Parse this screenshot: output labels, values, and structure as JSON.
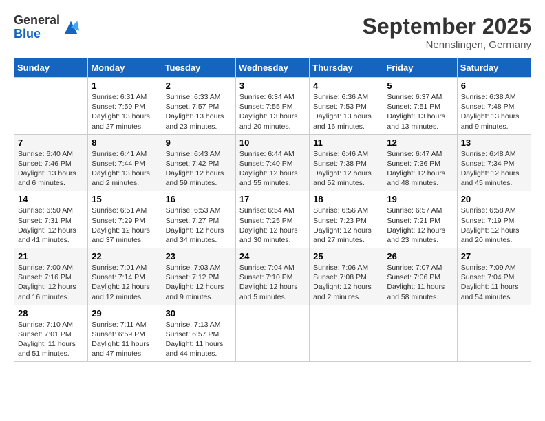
{
  "header": {
    "logo_general": "General",
    "logo_blue": "Blue",
    "month_title": "September 2025",
    "location": "Nennslingen, Germany"
  },
  "days_of_week": [
    "Sunday",
    "Monday",
    "Tuesday",
    "Wednesday",
    "Thursday",
    "Friday",
    "Saturday"
  ],
  "weeks": [
    [
      {
        "day": "",
        "sunrise": "",
        "sunset": "",
        "daylight": ""
      },
      {
        "day": "1",
        "sunrise": "Sunrise: 6:31 AM",
        "sunset": "Sunset: 7:59 PM",
        "daylight": "Daylight: 13 hours and 27 minutes."
      },
      {
        "day": "2",
        "sunrise": "Sunrise: 6:33 AM",
        "sunset": "Sunset: 7:57 PM",
        "daylight": "Daylight: 13 hours and 23 minutes."
      },
      {
        "day": "3",
        "sunrise": "Sunrise: 6:34 AM",
        "sunset": "Sunset: 7:55 PM",
        "daylight": "Daylight: 13 hours and 20 minutes."
      },
      {
        "day": "4",
        "sunrise": "Sunrise: 6:36 AM",
        "sunset": "Sunset: 7:53 PM",
        "daylight": "Daylight: 13 hours and 16 minutes."
      },
      {
        "day": "5",
        "sunrise": "Sunrise: 6:37 AM",
        "sunset": "Sunset: 7:51 PM",
        "daylight": "Daylight: 13 hours and 13 minutes."
      },
      {
        "day": "6",
        "sunrise": "Sunrise: 6:38 AM",
        "sunset": "Sunset: 7:48 PM",
        "daylight": "Daylight: 13 hours and 9 minutes."
      }
    ],
    [
      {
        "day": "7",
        "sunrise": "Sunrise: 6:40 AM",
        "sunset": "Sunset: 7:46 PM",
        "daylight": "Daylight: 13 hours and 6 minutes."
      },
      {
        "day": "8",
        "sunrise": "Sunrise: 6:41 AM",
        "sunset": "Sunset: 7:44 PM",
        "daylight": "Daylight: 13 hours and 2 minutes."
      },
      {
        "day": "9",
        "sunrise": "Sunrise: 6:43 AM",
        "sunset": "Sunset: 7:42 PM",
        "daylight": "Daylight: 12 hours and 59 minutes."
      },
      {
        "day": "10",
        "sunrise": "Sunrise: 6:44 AM",
        "sunset": "Sunset: 7:40 PM",
        "daylight": "Daylight: 12 hours and 55 minutes."
      },
      {
        "day": "11",
        "sunrise": "Sunrise: 6:46 AM",
        "sunset": "Sunset: 7:38 PM",
        "daylight": "Daylight: 12 hours and 52 minutes."
      },
      {
        "day": "12",
        "sunrise": "Sunrise: 6:47 AM",
        "sunset": "Sunset: 7:36 PM",
        "daylight": "Daylight: 12 hours and 48 minutes."
      },
      {
        "day": "13",
        "sunrise": "Sunrise: 6:48 AM",
        "sunset": "Sunset: 7:34 PM",
        "daylight": "Daylight: 12 hours and 45 minutes."
      }
    ],
    [
      {
        "day": "14",
        "sunrise": "Sunrise: 6:50 AM",
        "sunset": "Sunset: 7:31 PM",
        "daylight": "Daylight: 12 hours and 41 minutes."
      },
      {
        "day": "15",
        "sunrise": "Sunrise: 6:51 AM",
        "sunset": "Sunset: 7:29 PM",
        "daylight": "Daylight: 12 hours and 37 minutes."
      },
      {
        "day": "16",
        "sunrise": "Sunrise: 6:53 AM",
        "sunset": "Sunset: 7:27 PM",
        "daylight": "Daylight: 12 hours and 34 minutes."
      },
      {
        "day": "17",
        "sunrise": "Sunrise: 6:54 AM",
        "sunset": "Sunset: 7:25 PM",
        "daylight": "Daylight: 12 hours and 30 minutes."
      },
      {
        "day": "18",
        "sunrise": "Sunrise: 6:56 AM",
        "sunset": "Sunset: 7:23 PM",
        "daylight": "Daylight: 12 hours and 27 minutes."
      },
      {
        "day": "19",
        "sunrise": "Sunrise: 6:57 AM",
        "sunset": "Sunset: 7:21 PM",
        "daylight": "Daylight: 12 hours and 23 minutes."
      },
      {
        "day": "20",
        "sunrise": "Sunrise: 6:58 AM",
        "sunset": "Sunset: 7:19 PM",
        "daylight": "Daylight: 12 hours and 20 minutes."
      }
    ],
    [
      {
        "day": "21",
        "sunrise": "Sunrise: 7:00 AM",
        "sunset": "Sunset: 7:16 PM",
        "daylight": "Daylight: 12 hours and 16 minutes."
      },
      {
        "day": "22",
        "sunrise": "Sunrise: 7:01 AM",
        "sunset": "Sunset: 7:14 PM",
        "daylight": "Daylight: 12 hours and 12 minutes."
      },
      {
        "day": "23",
        "sunrise": "Sunrise: 7:03 AM",
        "sunset": "Sunset: 7:12 PM",
        "daylight": "Daylight: 12 hours and 9 minutes."
      },
      {
        "day": "24",
        "sunrise": "Sunrise: 7:04 AM",
        "sunset": "Sunset: 7:10 PM",
        "daylight": "Daylight: 12 hours and 5 minutes."
      },
      {
        "day": "25",
        "sunrise": "Sunrise: 7:06 AM",
        "sunset": "Sunset: 7:08 PM",
        "daylight": "Daylight: 12 hours and 2 minutes."
      },
      {
        "day": "26",
        "sunrise": "Sunrise: 7:07 AM",
        "sunset": "Sunset: 7:06 PM",
        "daylight": "Daylight: 11 hours and 58 minutes."
      },
      {
        "day": "27",
        "sunrise": "Sunrise: 7:09 AM",
        "sunset": "Sunset: 7:04 PM",
        "daylight": "Daylight: 11 hours and 54 minutes."
      }
    ],
    [
      {
        "day": "28",
        "sunrise": "Sunrise: 7:10 AM",
        "sunset": "Sunset: 7:01 PM",
        "daylight": "Daylight: 11 hours and 51 minutes."
      },
      {
        "day": "29",
        "sunrise": "Sunrise: 7:11 AM",
        "sunset": "Sunset: 6:59 PM",
        "daylight": "Daylight: 11 hours and 47 minutes."
      },
      {
        "day": "30",
        "sunrise": "Sunrise: 7:13 AM",
        "sunset": "Sunset: 6:57 PM",
        "daylight": "Daylight: 11 hours and 44 minutes."
      },
      {
        "day": "",
        "sunrise": "",
        "sunset": "",
        "daylight": ""
      },
      {
        "day": "",
        "sunrise": "",
        "sunset": "",
        "daylight": ""
      },
      {
        "day": "",
        "sunrise": "",
        "sunset": "",
        "daylight": ""
      },
      {
        "day": "",
        "sunrise": "",
        "sunset": "",
        "daylight": ""
      }
    ]
  ]
}
